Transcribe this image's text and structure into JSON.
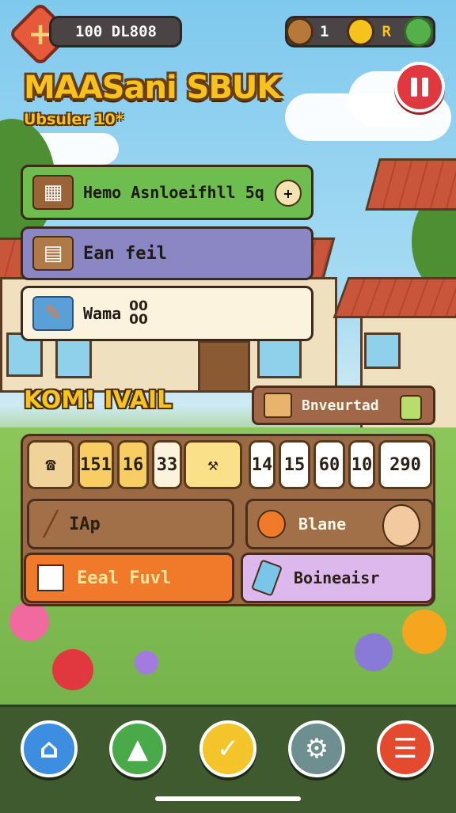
{
  "top": {
    "currency_value": "100 DL808",
    "coin_count": "1",
    "x_label": "R"
  },
  "header": {
    "title": "MAASani SBUK",
    "subtitle": "Ubsuler 10*"
  },
  "menu": {
    "items": [
      {
        "label": "Hemo Asnloeifhll 5q",
        "icon": "wooden-cart-icon",
        "color": "#6dbd4f"
      },
      {
        "label": "Ean feil",
        "icon": "book-icon",
        "color": "#8b86c4"
      },
      {
        "label": "Wama",
        "value_top": "00",
        "value_bottom": "00",
        "icon": "pencil-icon",
        "color": "#fbf3de"
      }
    ]
  },
  "section": {
    "title": "KOM! IVAIL",
    "button_label": "Bnveurtad"
  },
  "slots": {
    "values": [
      "151",
      "16",
      "33",
      "14",
      "15",
      "60",
      "10",
      "290"
    ]
  },
  "actions": {
    "left_top": "IAp",
    "right_top": "Blane",
    "left_bottom": "Eeal Fuvl",
    "right_bottom": "Boineaisr"
  },
  "nav": {
    "items": [
      "home",
      "tree",
      "check",
      "settings",
      "menu"
    ]
  },
  "colors": {
    "sky": "#8fd0ee",
    "accent_yellow": "#f6c21d",
    "panel_brown": "#9a6a45",
    "orange": "#f07a2a",
    "lavender": "#dcb8ec"
  }
}
